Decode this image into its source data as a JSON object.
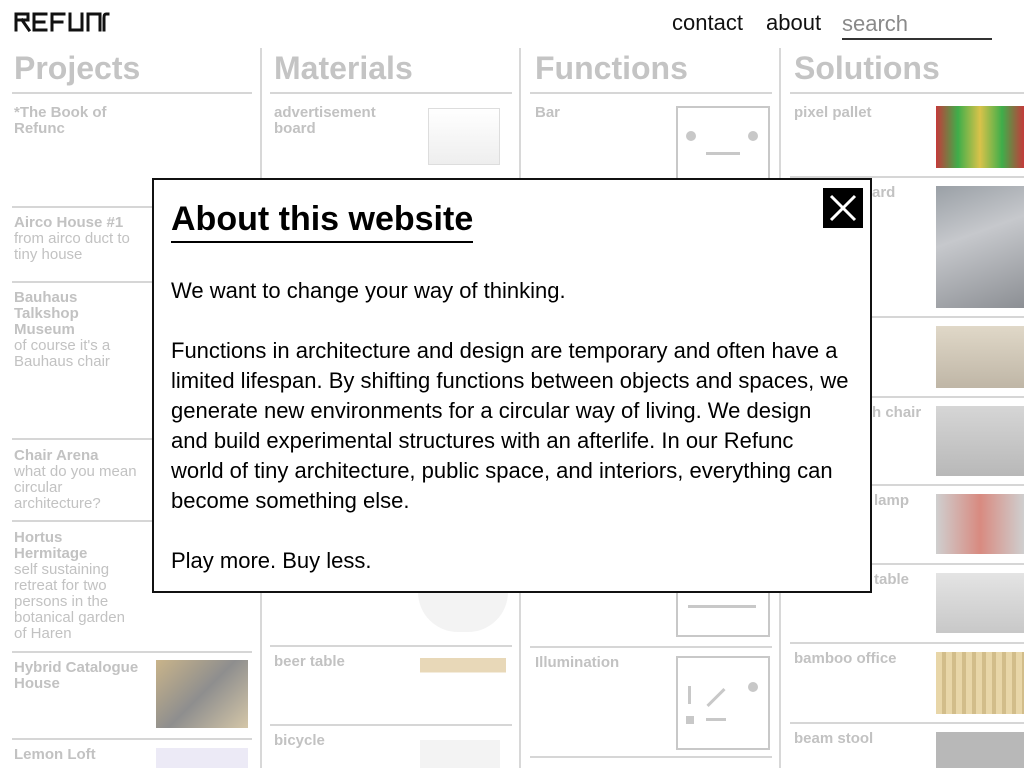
{
  "brand": "REFUNC",
  "nav": {
    "contact": "contact",
    "about": "about",
    "search_placeholder": "search"
  },
  "columns": {
    "projects": {
      "title": "Projects",
      "items": [
        {
          "title": "*The Book of Refunc",
          "sub": ""
        },
        {
          "title": "Airco House #1",
          "sub": "from airco duct to tiny house"
        },
        {
          "title": "Bauhaus Talkshop Museum",
          "sub": "of course it's a Bauhaus chair"
        },
        {
          "title": "Chair Arena",
          "sub": "what do you mean circular architecture?"
        },
        {
          "title": "Hortus Hermitage",
          "sub": "self sustaining retreat for two persons in the botanical garden of Haren"
        },
        {
          "title": "Hybrid Catalogue House",
          "sub": ""
        },
        {
          "title": "Lemon Loft",
          "sub": ""
        }
      ]
    },
    "materials": {
      "title": "Materials",
      "items": [
        {
          "title": "advertisement board"
        },
        {
          "title": "beer table"
        },
        {
          "title": "bicycle"
        }
      ]
    },
    "functions": {
      "title": "Functions",
      "items": [
        {
          "title": "Bar"
        },
        {
          "title": "Illumination"
        }
      ]
    },
    "solutions": {
      "title": "Solutions",
      "items": [
        {
          "title": "pixel pallet"
        },
        {
          "title": "ard"
        },
        {
          "title": "h chair"
        },
        {
          "title": "lamp"
        },
        {
          "title": "table"
        },
        {
          "title": "bamboo office"
        },
        {
          "title": "beam stool"
        }
      ]
    }
  },
  "modal": {
    "title": "About this website",
    "p1": "We want to change your way of thinking.",
    "p2": "Functions in architecture and design are temporary and often have a limited lifespan. By shifting functions between objects and spaces, we generate new environments for a circular way of living. We design and build experimental structures with an afterlife. In our Refunc world of tiny architecture, public space, and interiors, everything can become something else.",
    "p3": "Play more. Buy less."
  },
  "colors": {
    "accent": "#000000",
    "muted": "#c2c2c2"
  }
}
